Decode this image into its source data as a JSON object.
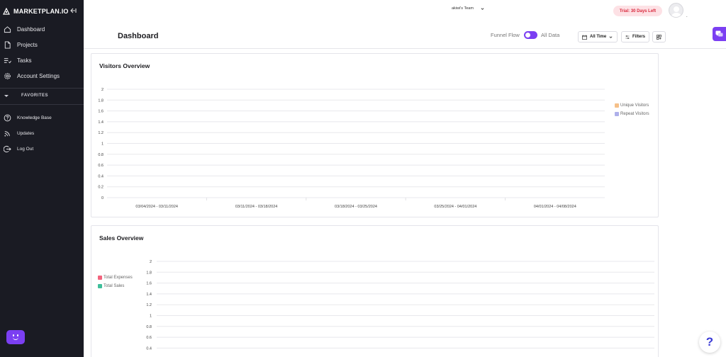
{
  "sidebar": {
    "brand": "MARKETPLAN.IO",
    "items": [
      {
        "label": "Dashboard"
      },
      {
        "label": "Projects"
      },
      {
        "label": "Tasks"
      },
      {
        "label": "Account Settings"
      }
    ],
    "favorites_label": "FAVORITES",
    "bottom_items": [
      {
        "label": "Knowledge Base"
      },
      {
        "label": "Updates"
      },
      {
        "label": "Log Out"
      }
    ]
  },
  "topbar": {
    "team": "akiwi's Team",
    "trial": "Trial: 30 Days Left",
    "avatar_caret": "."
  },
  "header": {
    "title": "Dashboard",
    "funnel_flow_label": "Funnel Flow",
    "all_data_label": "All Data",
    "all_time_label": "All Time",
    "filters_label": "Filters"
  },
  "colors": {
    "sidebar_bg": "#1a1b23",
    "accent": "#7b3ff2",
    "trial_bg": "#fde1e5",
    "trial_text": "#d92a3e"
  },
  "chart_data": [
    {
      "type": "bar",
      "title": "Visitors Overview",
      "categories": [
        "03/04/2024 - 03/11/2024",
        "03/11/2024 - 03/18/2024",
        "03/18/2024 - 03/25/2024",
        "03/25/2024 - 04/01/2024",
        "04/01/2024 - 04/08/2024"
      ],
      "series": [
        {
          "name": "Unique Visitors",
          "color": "#f5c089",
          "values": [
            0,
            0,
            0,
            0,
            0
          ]
        },
        {
          "name": "Repeat Visitors",
          "color": "#aeb0ea",
          "values": [
            0,
            0,
            0,
            0,
            0
          ]
        }
      ],
      "yticks": [
        "2",
        "1.8",
        "1.6",
        "1.4",
        "1.2",
        "1",
        "0.8",
        "0.6",
        "0.4",
        "0.2",
        "0"
      ],
      "ylim": [
        0,
        2
      ],
      "grid": true,
      "legend": "right"
    },
    {
      "type": "line",
      "title": "Sales Overview",
      "series": [
        {
          "name": "Total Expenses",
          "color": "#f2637e"
        },
        {
          "name": "Total Sales",
          "color": "#3fbf9b"
        }
      ],
      "yticks": [
        "2",
        "1.8",
        "1.6",
        "1.4",
        "1.2",
        "1",
        "0.8",
        "0.6",
        "0.4"
      ],
      "ylim": [
        0,
        2
      ],
      "grid": true,
      "legend": "left"
    }
  ]
}
